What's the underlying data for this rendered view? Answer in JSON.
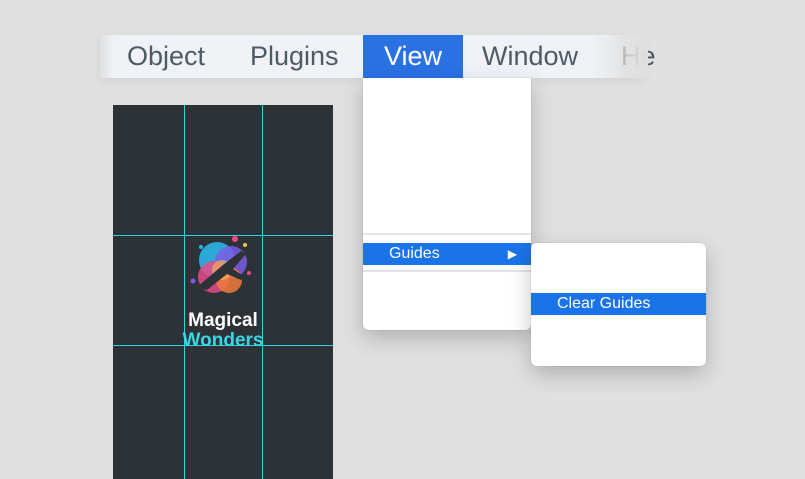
{
  "menubar": {
    "items": [
      {
        "label": "Object"
      },
      {
        "label": "Plugins"
      },
      {
        "label": "View",
        "active": true
      },
      {
        "label": "Window"
      },
      {
        "label": "He"
      }
    ]
  },
  "view_menu": {
    "guides_label": "Guides",
    "guides_arrow": "▶"
  },
  "guides_submenu": {
    "clear_guides_label": "Clear Guides"
  },
  "artboard": {
    "logo_line1": "Magical",
    "logo_line2": "Wonders"
  },
  "colors": {
    "accent": "#1a73e8",
    "menu_active": "#2a71e4",
    "artboard_bg": "#2c3236",
    "guide": "#2fd2e0",
    "logo_cyan": "#3ad6e6"
  }
}
